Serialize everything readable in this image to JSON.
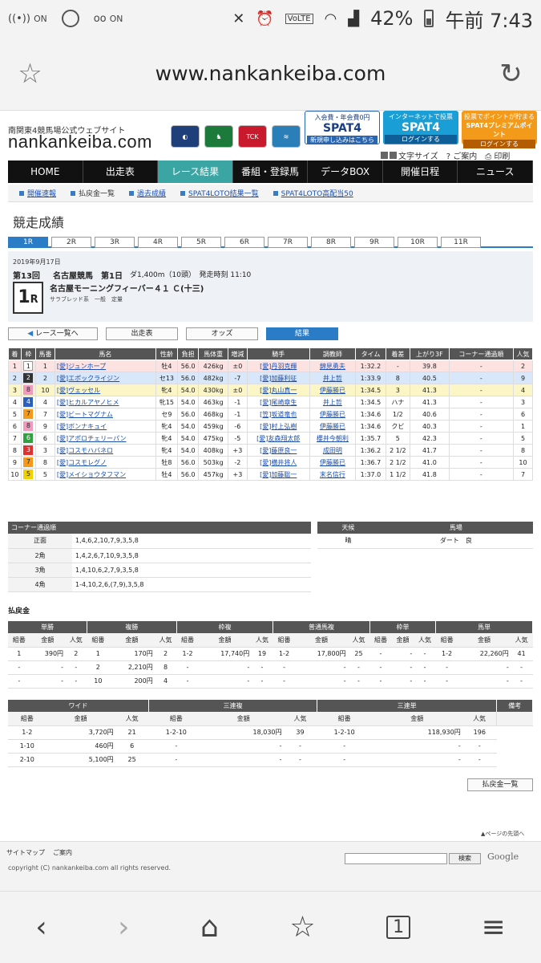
{
  "statusbar": {
    "battery": "42%",
    "time": "午前 7:43",
    "volte": "VoLTE",
    "on1": "ON",
    "on2": "ON"
  },
  "browser": {
    "url": "www.nankankeiba.com"
  },
  "site": {
    "subtitle": "南関東4競馬場公式ウェブサイト",
    "logo": "nankankeiba.com",
    "banners": [
      {
        "l1": "入会費・年会費0円",
        "l2": "SPAT4",
        "l3": "新規申し込みはこちら"
      },
      {
        "l1": "インターネットで投票",
        "l2": "SPAT4",
        "l3": "ログインする"
      },
      {
        "l1": "投票でポイントが貯まる",
        "l2": "SPAT4プレミアムポイント",
        "l3": "ログインする"
      }
    ],
    "utils": [
      "文字サイズ",
      "ご案内",
      "印刷"
    ],
    "nav": [
      "HOME",
      "出走表",
      "レース結果",
      "番組・登録馬",
      "データBOX",
      "開催日程",
      "ニュース"
    ],
    "subnav": [
      "開催速報",
      "払戻金一覧",
      "過去成績",
      "SPAT4LOTO結果一覧",
      "SPAT4LOTO高配当50"
    ]
  },
  "page": {
    "title": "競走成績",
    "race_tabs": [
      "1R",
      "2R",
      "3R",
      "4R",
      "5R",
      "6R",
      "7R",
      "8R",
      "9R",
      "10R",
      "11R"
    ],
    "date": "2019年9月17日",
    "meet": "第13回",
    "meet2": "名古屋競馬　第1日",
    "cond": "ダ1,400m（10頭）　発走時刻 11:10",
    "race_num": "1",
    "race_r": "R",
    "race_name": "名古屋モーニングフィーバー４１ Ｃ(十三)",
    "race_class": "サラブレッド系　一般　定量",
    "buttons": [
      "レース一覧へ",
      "出走表",
      "オッズ",
      "結果"
    ]
  },
  "results": {
    "headers": [
      "着",
      "枠",
      "馬番",
      "馬名",
      "性齢",
      "負担",
      "馬体重",
      "増減",
      "騎手",
      "調教師",
      "タイム",
      "着差",
      "上がり3F",
      "コーナー通過順",
      "人気"
    ],
    "rows": [
      [
        "1",
        "1",
        "1",
        "[愛]ジュンホープ",
        "牡4",
        "56.0",
        "426kg",
        "±0",
        "[愛]丹羽克輝",
        "錦見勇夫",
        "1:32.2",
        "-",
        "39.8",
        "-",
        "2"
      ],
      [
        "2",
        "2",
        "2",
        "[愛]エポックライジン",
        "セ13",
        "56.0",
        "482kg",
        "-7",
        "[愛]加藤利征",
        "井上哲",
        "1:33.9",
        "8",
        "40.5",
        "-",
        "9"
      ],
      [
        "3",
        "8",
        "10",
        "[愛]ヴェッセル",
        "牝4",
        "54.0",
        "430kg",
        "±0",
        "[愛]丸山真一",
        "伊藤勝已",
        "1:34.5",
        "3",
        "41.3",
        "-",
        "4"
      ],
      [
        "4",
        "4",
        "4",
        "[愛]ヒカルアヤノヒメ",
        "牝15",
        "54.0",
        "463kg",
        "-1",
        "[愛]尾崎章生",
        "井上哲",
        "1:34.5",
        "ハナ",
        "41.3",
        "-",
        "3"
      ],
      [
        "5",
        "7",
        "7",
        "[愛]ビートマグナム",
        "セ9",
        "56.0",
        "468kg",
        "-1",
        "[笠]坂道竜也",
        "伊藤勝已",
        "1:34.6",
        "1/2",
        "40.6",
        "-",
        "6"
      ],
      [
        "6",
        "8",
        "9",
        "[愛]ボンナキュイ",
        "牝4",
        "54.0",
        "459kg",
        "-6",
        "[愛]村上弘樹",
        "伊藤勝已",
        "1:34.6",
        "クビ",
        "40.3",
        "-",
        "1"
      ],
      [
        "7",
        "6",
        "6",
        "[愛]アポロチェリーパン",
        "牝4",
        "54.0",
        "475kg",
        "-5",
        "[愛]友森翔太郎",
        "櫻井今朝利",
        "1:35.7",
        "5",
        "42.3",
        "-",
        "5"
      ],
      [
        "8",
        "3",
        "3",
        "[愛]コスモハバネロ",
        "牝4",
        "54.0",
        "408kg",
        "+3",
        "[愛]藤原良一",
        "成田明",
        "1:36.2",
        "2 1/2",
        "41.7",
        "-",
        "8"
      ],
      [
        "9",
        "7",
        "8",
        "[愛]コスモレグノ",
        "牡8",
        "56.0",
        "503kg",
        "-2",
        "[愛]横井将人",
        "伊藤勝已",
        "1:36.7",
        "2 1/2",
        "41.0",
        "-",
        "10"
      ],
      [
        "10",
        "5",
        "5",
        "[愛]メイショウタフマン",
        "牡4",
        "56.0",
        "457kg",
        "+3",
        "[愛]加藤聡一",
        "末名信行",
        "1:37.0",
        "1 1/2",
        "41.8",
        "-",
        "7"
      ]
    ]
  },
  "corner": {
    "title": "コーナー通過順",
    "rows": [
      [
        "正面",
        "1,4,6,2,10,7,9,3,5,8"
      ],
      [
        "2角",
        "1,4,2,6,7,10,9,3,5,8"
      ],
      [
        "3角",
        "1,4,10,6,2,7,9,3,5,8"
      ],
      [
        "4角",
        "1-4,10,2,6,(7,9),3,5,8"
      ]
    ]
  },
  "weather": {
    "h1": "天候",
    "h2": "馬場",
    "v1": "晴",
    "v2": "ダート　良"
  },
  "payout": {
    "title": "払戻金",
    "group1": [
      "単勝",
      "複勝",
      "枠複",
      "普通馬複",
      "枠単",
      "馬単"
    ],
    "sub": [
      "組番",
      "金額",
      "人気"
    ],
    "rows1": [
      [
        "1",
        "390円",
        "2",
        "1",
        "170円",
        "2",
        "1-2",
        "17,740円",
        "19",
        "1-2",
        "17,800円",
        "25",
        "-",
        "-",
        "-",
        "1-2",
        "22,260円",
        "41"
      ],
      [
        "-",
        "-",
        "-",
        "2",
        "2,210円",
        "8",
        "-",
        "-",
        "-",
        "-",
        "-",
        "-",
        "-",
        "-",
        "-",
        "-",
        "-",
        "-"
      ],
      [
        "-",
        "-",
        "-",
        "10",
        "200円",
        "4",
        "-",
        "-",
        "-",
        "-",
        "-",
        "-",
        "-",
        "-",
        "-",
        "-",
        "-",
        "-"
      ]
    ],
    "group2": [
      "ワイド",
      "三連複",
      "三連単",
      "備考"
    ],
    "rows2": [
      [
        "1-2",
        "3,720円",
        "21",
        "1-2-10",
        "18,030円",
        "39",
        "1-2-10",
        "118,930円",
        "196"
      ],
      [
        "1-10",
        "460円",
        "6",
        "-",
        "-",
        "-",
        "-",
        "-",
        "-"
      ],
      [
        "2-10",
        "5,100円",
        "25",
        "-",
        "-",
        "-",
        "-",
        "-",
        "-"
      ]
    ],
    "list_button": "払戻金一覧"
  },
  "footer": {
    "to_top": "ページの先頭へ",
    "links": [
      "サイトマップ",
      "ご案内"
    ],
    "copyright": "copyright (C) nankankeiba.com all rights reserved.",
    "search_button": "検索",
    "google": "Google"
  }
}
